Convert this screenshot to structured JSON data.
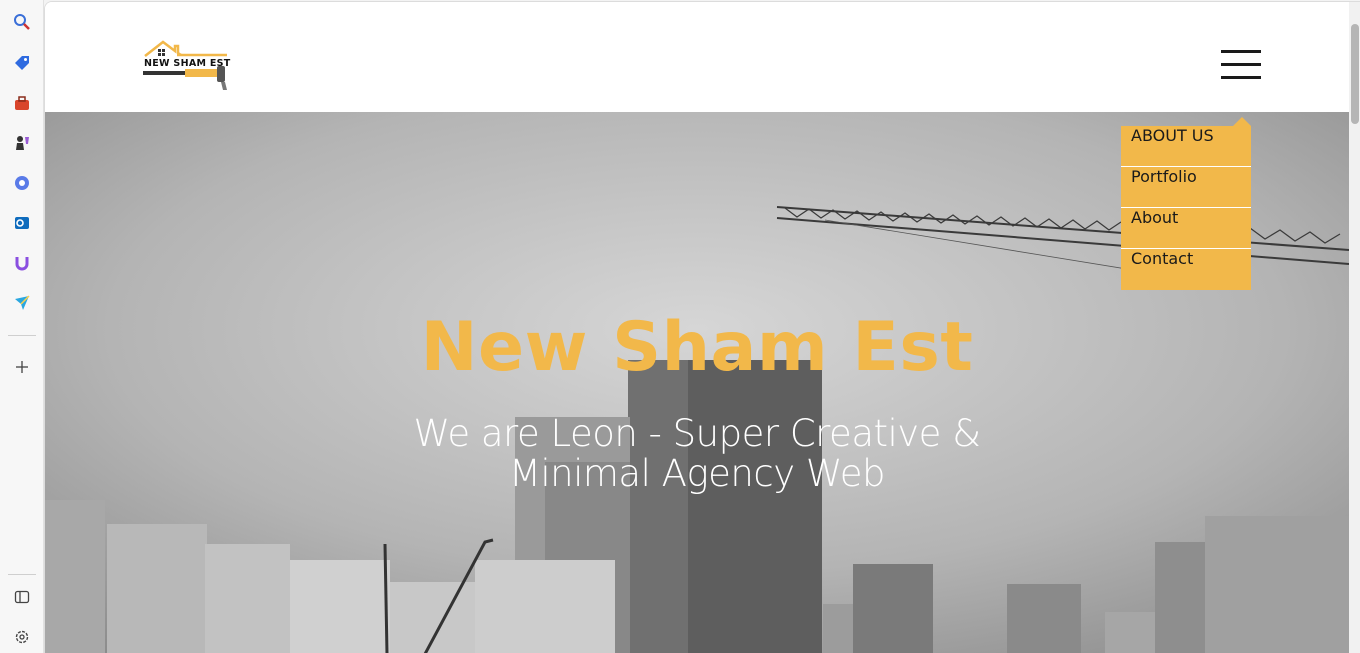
{
  "browser_sidebar": {
    "icons": [
      "search-icon",
      "tag-icon",
      "toolbox-icon",
      "chess-icon",
      "copilot-icon",
      "outlook-icon",
      "magnet-icon",
      "send-icon",
      "add-icon",
      "sidebar-toggle-icon",
      "settings-icon"
    ]
  },
  "header": {
    "logo_text": "NEW SHAM EST"
  },
  "hero": {
    "title": "New Sham Est",
    "subtitle_line1": "We are Leon - Super Creative &",
    "subtitle_line2": "Minimal Agency Web"
  },
  "menu": {
    "items": [
      {
        "label": "ABOUT US"
      },
      {
        "label": "Portfolio"
      },
      {
        "label": "About"
      },
      {
        "label": "Contact"
      }
    ]
  },
  "colors": {
    "accent": "#f2b84a",
    "text_dark": "#1a1a1a"
  }
}
